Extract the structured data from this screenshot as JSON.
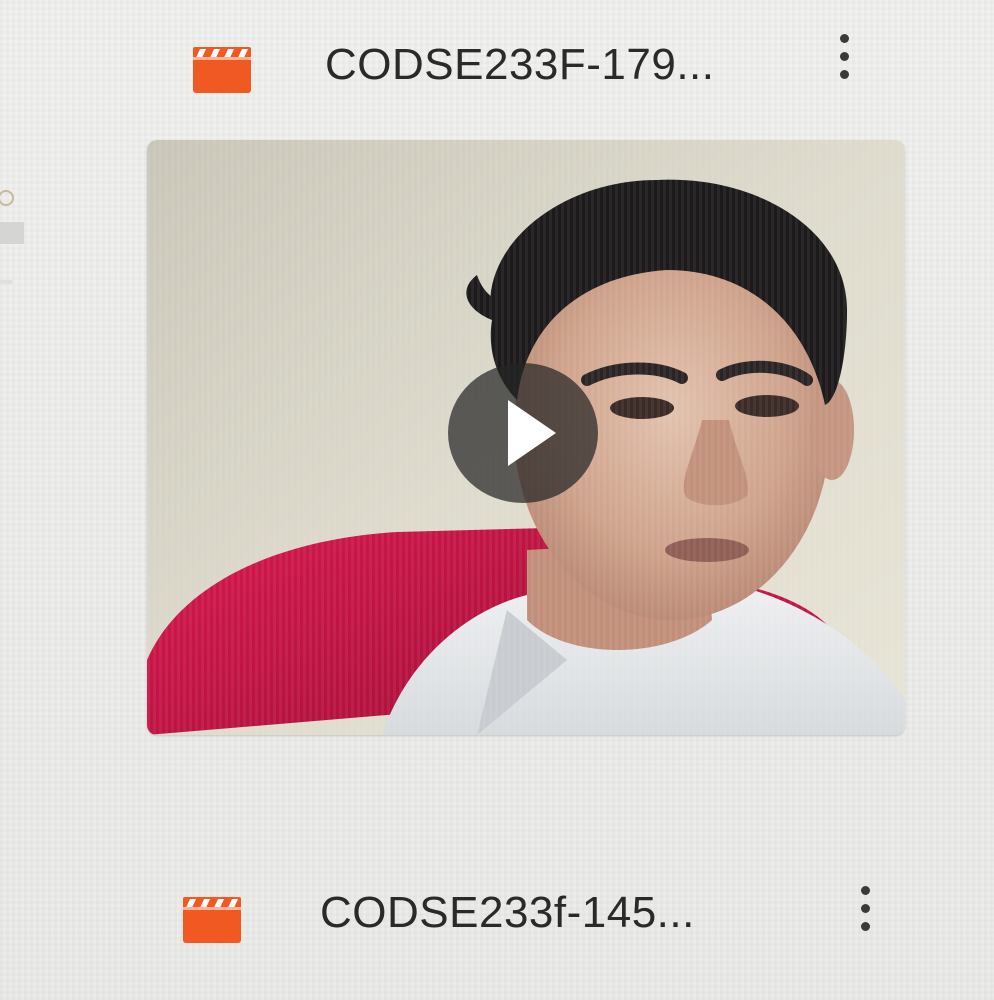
{
  "files": [
    {
      "name": "CODSE233F-179...",
      "icon": "video-file-icon",
      "menu_icon": "more-vert-icon",
      "has_thumbnail": true,
      "thumbnail_overlay_icon": "play-icon"
    },
    {
      "name": "CODSE233f-145...",
      "icon": "video-file-icon",
      "menu_icon": "more-vert-icon",
      "has_thumbnail": false
    }
  ],
  "colors": {
    "file_icon": "#f05a22",
    "background": "#ececea",
    "text": "#2a2a2a",
    "play_overlay": "#262626"
  }
}
